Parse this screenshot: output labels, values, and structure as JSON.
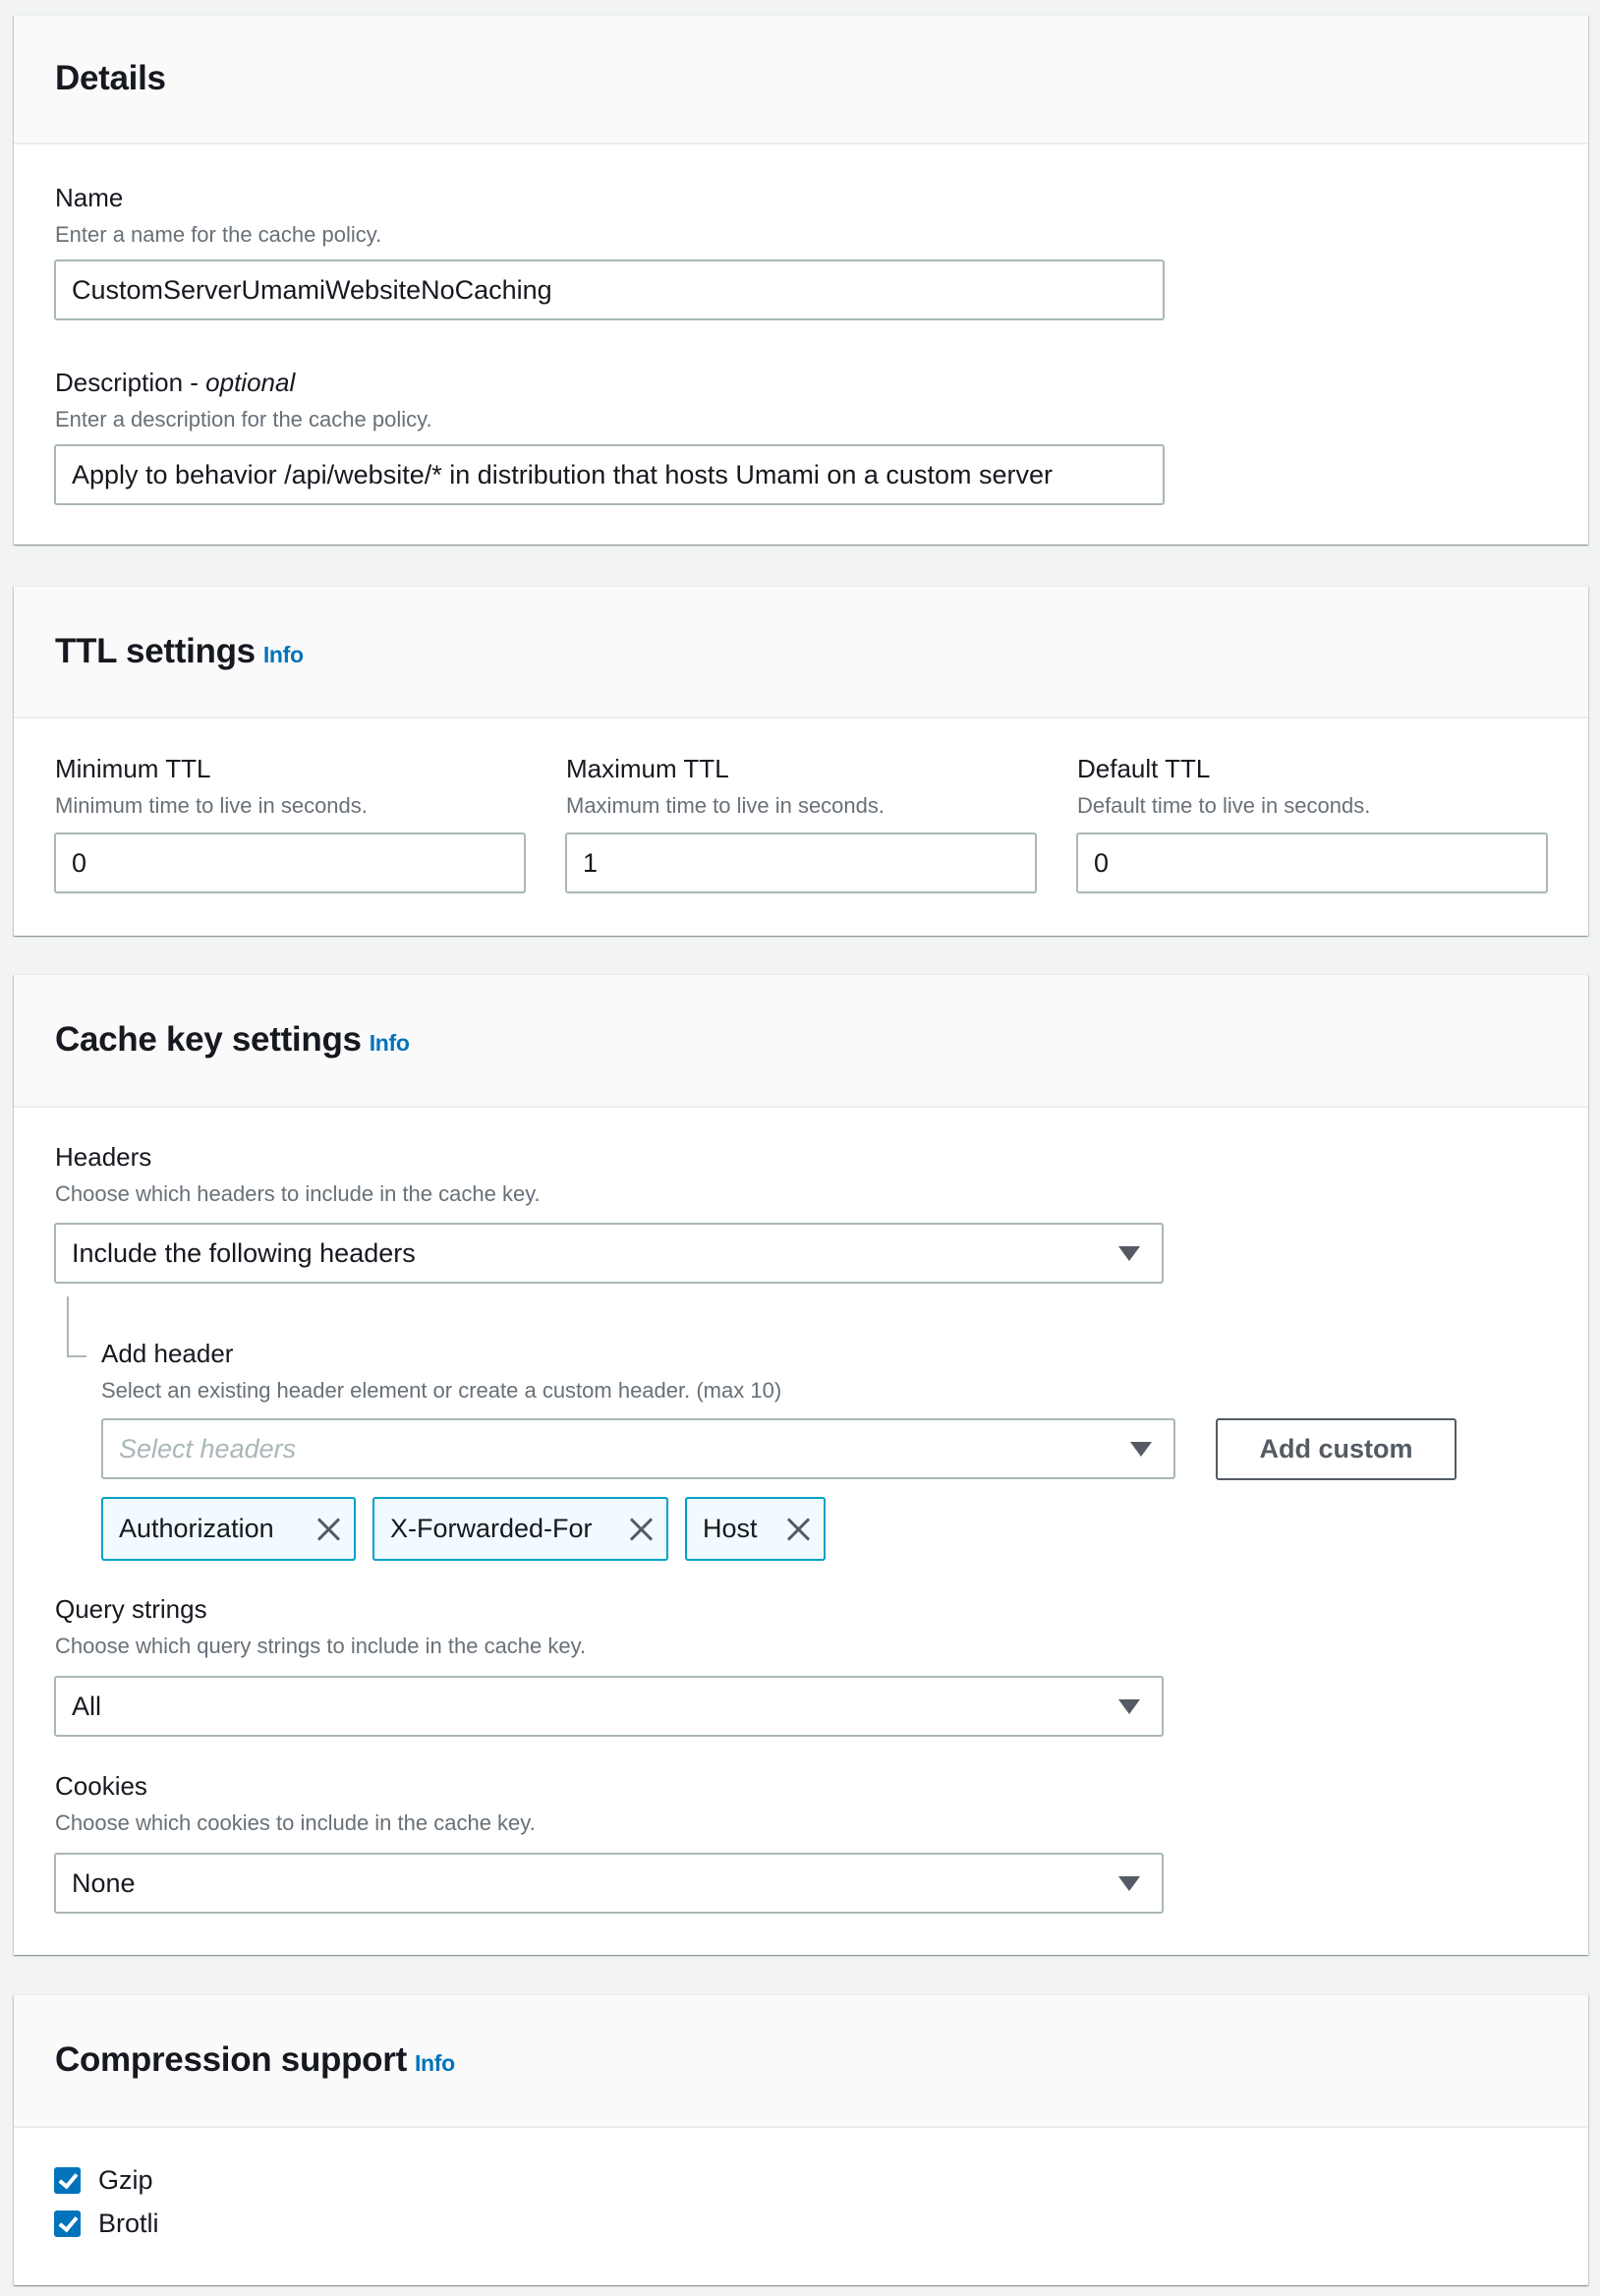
{
  "details": {
    "title": "Details",
    "name": {
      "label": "Name",
      "description": "Enter a name for the cache policy.",
      "value": "CustomServerUmamiWebsiteNoCaching"
    },
    "description": {
      "label": "Description - ",
      "label_suffix": "optional",
      "description": "Enter a description for the cache policy.",
      "value": "Apply to behavior /api/website/* in distribution that hosts Umami on a custom server"
    }
  },
  "ttl": {
    "title": "TTL settings",
    "info": "Info",
    "minimum": {
      "label": "Minimum TTL",
      "description": "Minimum time to live in seconds.",
      "value": "0"
    },
    "maximum": {
      "label": "Maximum TTL",
      "description": "Maximum time to live in seconds.",
      "value": "1"
    },
    "default": {
      "label": "Default TTL",
      "description": "Default time to live in seconds.",
      "value": "0"
    }
  },
  "cache_key": {
    "title": "Cache key settings",
    "info": "Info",
    "headers": {
      "label": "Headers",
      "description": "Choose which headers to include in the cache key.",
      "selected": "Include the following headers"
    },
    "add_header": {
      "label": "Add header",
      "description": "Select an existing header element or create a custom header. (max 10)",
      "placeholder": "Select headers",
      "add_custom_label": "Add custom",
      "tokens": [
        "Authorization",
        "X-Forwarded-For",
        "Host"
      ]
    },
    "query_strings": {
      "label": "Query strings",
      "description": "Choose which query strings to include in the cache key.",
      "selected": "All"
    },
    "cookies": {
      "label": "Cookies",
      "description": "Choose which cookies to include in the cache key.",
      "selected": "None"
    }
  },
  "compression": {
    "title": "Compression support",
    "info": "Info",
    "options": [
      {
        "label": "Gzip",
        "checked": true
      },
      {
        "label": "Brotli",
        "checked": true
      }
    ]
  },
  "colors": {
    "accent": "#0073bb",
    "token_border": "#00a1c9",
    "token_bg": "#f1faff",
    "input_border": "#aab7b8",
    "page_bg": "#f2f3f3"
  }
}
